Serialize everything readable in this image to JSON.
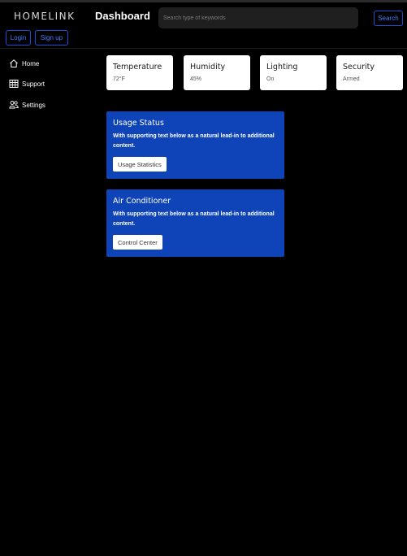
{
  "header": {
    "brand": "HOMELINK",
    "title": "Dashboard",
    "search_placeholder": "Search type of keywords",
    "search_label": "Search",
    "login_label": "Login",
    "signup_label": "Sign up"
  },
  "sidebar": {
    "items": [
      {
        "label": "Home",
        "icon": "home-icon"
      },
      {
        "label": "Support",
        "icon": "table-icon"
      },
      {
        "label": "Settings",
        "icon": "people-icon"
      }
    ]
  },
  "stats": [
    {
      "title": "Temperature",
      "value": "72°F"
    },
    {
      "title": "Humidity",
      "value": "45%"
    },
    {
      "title": "Lighting",
      "value": "On"
    },
    {
      "title": "Security",
      "value": "Armed"
    }
  ],
  "cards": [
    {
      "title": "Usage Status",
      "text": "With supporting text below as a natural lead-in to additional content.",
      "button": "Usage Statistics"
    },
    {
      "title": "Air Conditioner",
      "text": "With supporting text below as a natural lead-in to additional content.",
      "button": "Control Center"
    }
  ],
  "colors": {
    "background": "#000000",
    "card_blue": "#0e44b7",
    "accent_blue": "#1b4fd6"
  }
}
